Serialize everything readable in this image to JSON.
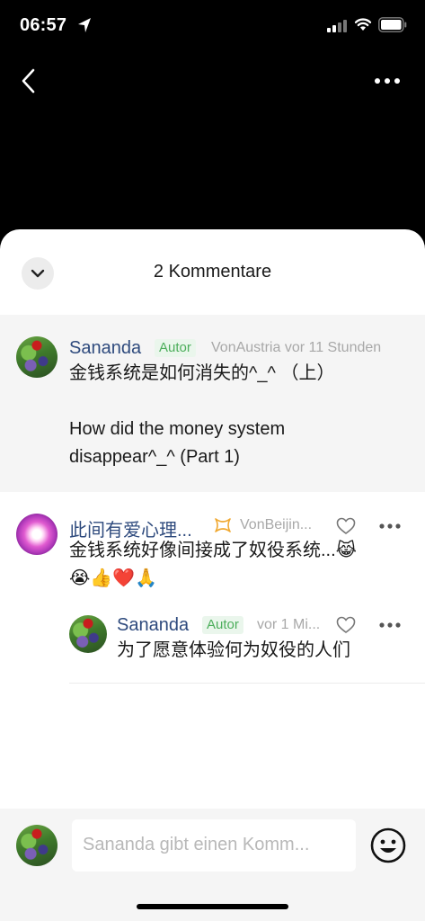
{
  "status_bar": {
    "time": "06:57"
  },
  "sheet": {
    "title": "2 Kommentare"
  },
  "comments": [
    {
      "name": "Sananda",
      "badge": "Autor",
      "meta": "VonAustria vor 11 Stunden",
      "text": "金钱系统是如何消失的^_^ （上）\n\nHow did the money system\ndisappear^_^ (Part 1)"
    },
    {
      "name": "此间有爱心理...",
      "meta": "VonBeijin...",
      "text": "金钱系统好像间接成了奴役系统...😹\n😭👍❤️🙏",
      "reply": {
        "name": "Sananda",
        "badge": "Autor",
        "meta": "vor 1 Mi...",
        "text": "为了愿意体验何为奴役的人们"
      }
    }
  ],
  "input": {
    "placeholder": "Sananda gibt einen Komm..."
  },
  "colors": {
    "name": "#2e4a7d",
    "badge_text": "#4cae5b",
    "badge_bg": "#eaf6ec",
    "meta": "#a8a8a8"
  },
  "icons": [
    "location-arrow-icon",
    "signal-icon",
    "wifi-icon",
    "battery-icon",
    "back-chevron-icon",
    "more-dots-icon",
    "chevron-down-icon",
    "heart-icon",
    "emoji-smile-icon",
    "vip-ribbon-icon"
  ]
}
